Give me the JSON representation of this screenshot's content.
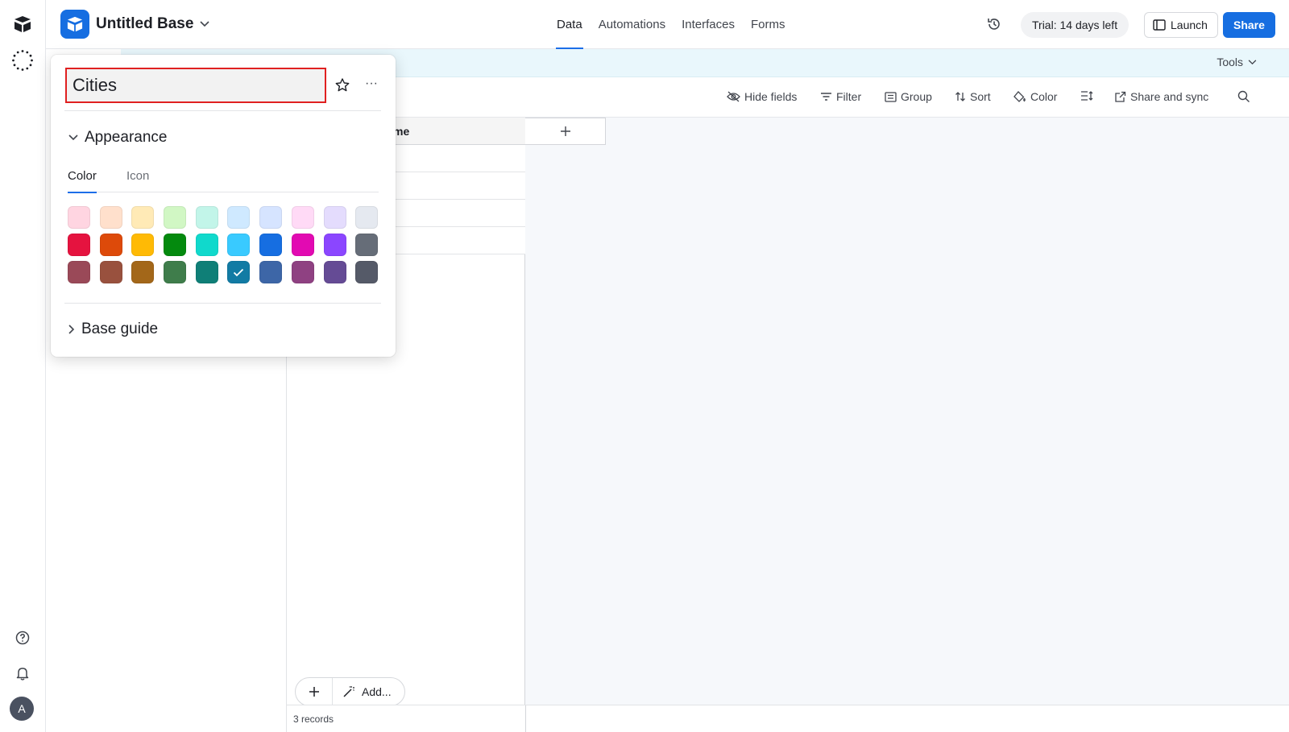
{
  "app": {
    "base_name": "Untitled Base"
  },
  "nav": {
    "tabs": [
      {
        "label": "Data",
        "active": true
      },
      {
        "label": "Automations",
        "active": false
      },
      {
        "label": "Interfaces",
        "active": false
      },
      {
        "label": "Forms",
        "active": false
      }
    ]
  },
  "header": {
    "trial_label": "Trial: 14 days left",
    "launch_label": "Launch",
    "share_label": "Share"
  },
  "band": {
    "tools_label": "Tools"
  },
  "toolbar": {
    "hide_fields": "Hide fields",
    "filter": "Filter",
    "group": "Group",
    "sort": "Sort",
    "color": "Color",
    "share_sync": "Share and sync"
  },
  "grid": {
    "primary_header": "me",
    "add_label": "Add...",
    "records_label": "3 records"
  },
  "popover": {
    "table_name": "Cities",
    "appearance_label": "Appearance",
    "tabs": [
      {
        "label": "Color",
        "active": true
      },
      {
        "label": "Icon",
        "active": false
      }
    ],
    "swatches": [
      "#ffd5e1",
      "#ffe0cc",
      "#ffeab6",
      "#d1f7c4",
      "#c2f5e9",
      "#cfe9ff",
      "#d6e4ff",
      "#ffdaf6",
      "#e4dcfd",
      "#e5e9f0",
      "#e5133f",
      "#dd4a0a",
      "#ffba05",
      "#048a0e",
      "#10d9cc",
      "#39caff",
      "#166ee1",
      "#e20ab2",
      "#8b46ff",
      "#666d78",
      "#9a4958",
      "#99513e",
      "#a36719",
      "#3f7d4b",
      "#0f7f77",
      "#127ba4",
      "#3d66a7",
      "#8f4182",
      "#654b95",
      "#555a68"
    ],
    "selected_swatch": 25,
    "base_guide_label": "Base guide"
  }
}
